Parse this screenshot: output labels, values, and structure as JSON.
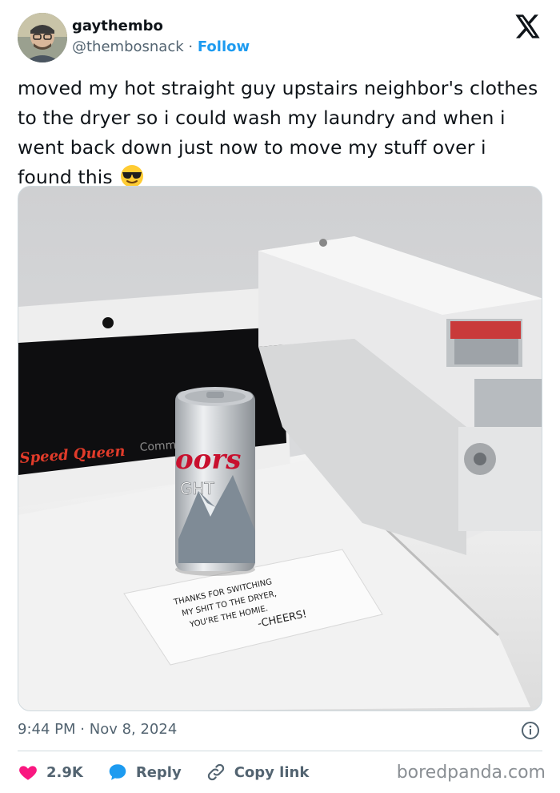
{
  "header": {
    "display_name": "gaythembo",
    "handle": "@thembosnack",
    "separator": "·",
    "follow_label": "Follow"
  },
  "tweet": {
    "text": "moved my hot straight guy upstairs neighbor's clothes to the dryer so i could wash my laundry and when i went back down just now to move my stuff over i found this",
    "emoji": "smiling-face-with-sunglasses"
  },
  "photo": {
    "can_brand": "Coors",
    "can_brand_line2": "LIGHT",
    "can_visible_1": "oors",
    "can_visible_2": "GHT",
    "machine_brand": "Speed Queen",
    "machine_sub": "Comme",
    "note_lines": [
      "THANKS FOR SWITCHING",
      "MY SHIT TO THE DRYER,",
      "YOU'RE THE HOMIE.",
      "-CHEERS!"
    ]
  },
  "footer": {
    "time": "9:44 PM",
    "dot": "·",
    "date": "Nov 8, 2024",
    "likes": "2.9K",
    "reply_label": "Reply",
    "copy_label": "Copy link",
    "watermark": "boredpanda.com"
  },
  "colors": {
    "follow_blue": "#1d9bf0",
    "like_red": "#f91880",
    "reply_blue": "#1d9bf0",
    "muted": "#536471"
  }
}
